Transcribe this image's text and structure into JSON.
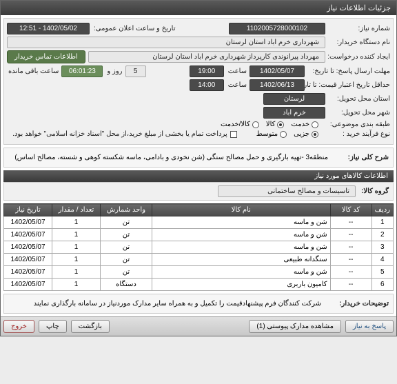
{
  "window": {
    "title": "جزئیات اطلاعات نیاز"
  },
  "form": {
    "req_no_label": "شماره نیاز:",
    "req_no": "1102005728000102",
    "announce_label": "تاریخ و ساعت اعلان عمومی:",
    "announce_val": "1402/05/02 - 12:51",
    "buyer_label": "نام دستگاه خریدار:",
    "buyer_val": "شهرداری خرم اباد استان لرستان",
    "creator_label": "ایجاد کننده درخواست:",
    "creator_val": "مهرداد پیرانوندی کارپرداز شهرداری خرم اباد استان لرستان",
    "contact_btn": "اطلاعات تماس خریدار",
    "deadline_label": "مهلت ارسال پاسخ: تا تاریخ:",
    "deadline_date": "1402/05/07",
    "deadline_time_label": "ساعت",
    "deadline_time": "19:00",
    "days_label": "روز و",
    "days_val": "5",
    "countdown": "06:01:23",
    "remain_label": "ساعت باقی مانده",
    "valid_label": "حداقل تاریخ اعتبار قیمت: تا تاریخ:",
    "valid_date": "1402/06/13",
    "valid_time_label": "ساعت",
    "valid_time": "14:00",
    "province_label": "استان محل تحویل:",
    "province_val": "لرستان",
    "city_label": "شهر محل تحویل:",
    "city_val": "خرم اباد",
    "category_label": "طبقه بندی موضوعی:",
    "cat_service": "خدمت",
    "cat_goods": "کالا",
    "cat_both": "کالا/خدمت",
    "purchase_type_label": "نوع فرآیند خرید :",
    "pt_partial": "جزیی",
    "pt_medium": "متوسط",
    "payment_note": "پرداخت تمام یا بخشی از مبلغ خرید،از محل \"اسناد خزانه اسلامی\" خواهد بود.",
    "summary_label": "شرح کلی نیاز:",
    "summary_val": "منطقه3 -تهیه بارگیری و حمل مصالح سنگی (شن نخودی و بادامی، ماسه شکسته کوهی و شسته، مصالح اساس)"
  },
  "section2": {
    "title": "اطلاعات کالاهای مورد نیاز",
    "group_label": "گروه کالا:",
    "group_val": "تاسیسات و مصالح ساختمانی"
  },
  "table": {
    "headers": {
      "row": "ردیف",
      "code": "کد کالا",
      "name": "نام کالا",
      "unit": "واحد شمارش",
      "qty": "تعداد / مقدار",
      "date": "تاریخ نیاز"
    },
    "rows": [
      {
        "n": "1",
        "code": "--",
        "name": "شن و ماسه",
        "unit": "تن",
        "qty": "1",
        "date": "1402/05/07"
      },
      {
        "n": "2",
        "code": "--",
        "name": "شن و ماسه",
        "unit": "تن",
        "qty": "1",
        "date": "1402/05/07"
      },
      {
        "n": "3",
        "code": "--",
        "name": "شن و ماسه",
        "unit": "تن",
        "qty": "1",
        "date": "1402/05/07"
      },
      {
        "n": "4",
        "code": "--",
        "name": "سنگدانه طبیعی",
        "unit": "تن",
        "qty": "1",
        "date": "1402/05/07"
      },
      {
        "n": "5",
        "code": "--",
        "name": "شن و ماسه",
        "unit": "تن",
        "qty": "1",
        "date": "1402/05/07"
      },
      {
        "n": "6",
        "code": "--",
        "name": "کامیون باربری",
        "unit": "دستگاه",
        "qty": "1",
        "date": "1402/05/07"
      }
    ]
  },
  "buyer_notes": {
    "label": "توضیحات خریدار:",
    "val": "شرکت کنندگان فرم پیشنهادقیمت را تکمیل و به همراه سایر مدارک موردنیاز در سامانه بارگذاری نمایند"
  },
  "footer": {
    "reply": "پاسخ به نیاز",
    "attach": "مشاهده مدارک پیوستی (1)",
    "recreate": "بازگشت",
    "print": "چاپ",
    "exit": "خروج"
  }
}
